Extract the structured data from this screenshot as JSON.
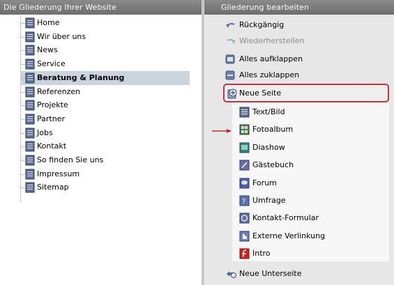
{
  "left": {
    "header": "Die Gliederung Ihrer Website",
    "items": [
      {
        "label": "Home",
        "selected": false
      },
      {
        "label": "Wir über uns",
        "selected": false
      },
      {
        "label": "News",
        "selected": false
      },
      {
        "label": "Service",
        "selected": false
      },
      {
        "label": "Beratung & Planung",
        "selected": true
      },
      {
        "label": "Referenzen",
        "selected": false
      },
      {
        "label": "Projekte",
        "selected": false
      },
      {
        "label": "Partner",
        "selected": false
      },
      {
        "label": "Jobs",
        "selected": false
      },
      {
        "label": "Kontakt",
        "selected": false
      },
      {
        "label": "So finden Sie uns",
        "selected": false
      },
      {
        "label": "Impressum",
        "selected": false
      },
      {
        "label": "Sitemap",
        "selected": false
      }
    ]
  },
  "right": {
    "header": "Gliederung bearbeiten",
    "undo": "Rückgängig",
    "redo": "Wiederherstellen",
    "expand_all": "Alles aufklappen",
    "collapse_all": "Alles zuklappen",
    "new_page": "Neue Seite",
    "page_types": [
      {
        "label": "Text/Bild",
        "icon": "text-image-icon"
      },
      {
        "label": "Fotoalbum",
        "icon": "photo-album-icon"
      },
      {
        "label": "Diashow",
        "icon": "slideshow-icon"
      },
      {
        "label": "Gästebuch",
        "icon": "guestbook-icon"
      },
      {
        "label": "Forum",
        "icon": "forum-icon"
      },
      {
        "label": "Umfrage",
        "icon": "poll-icon"
      },
      {
        "label": "Kontakt-Formular",
        "icon": "contact-form-icon"
      },
      {
        "label": "Externe Verlinkung",
        "icon": "external-link-icon"
      },
      {
        "label": "Intro",
        "icon": "flash-intro-icon"
      }
    ],
    "new_subpage": "Neue Unterseite"
  },
  "colors": {
    "header_bg": "#7a7a7a",
    "selected_row": "#c9d4de",
    "highlight_border": "#c8323a",
    "annotation_arrow": "#d0202a"
  }
}
